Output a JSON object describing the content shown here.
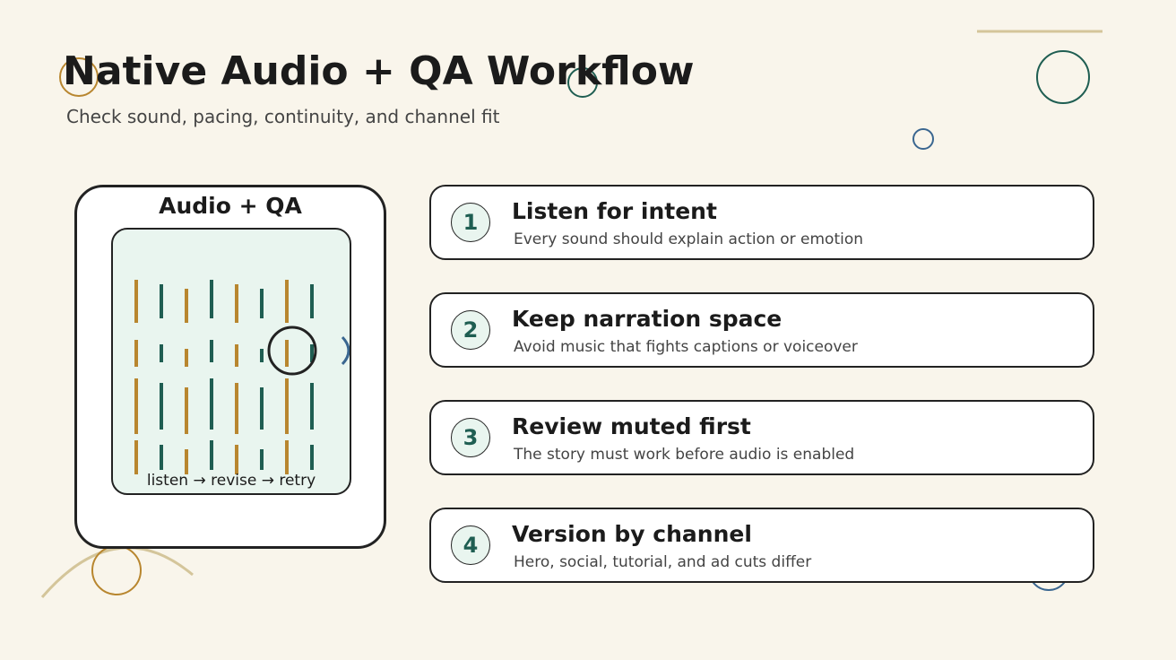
{
  "title": "Native Audio + QA Workflow",
  "subtitle": "Check sound, pacing, continuity, and channel fit",
  "card": {
    "title": "Audio + QA",
    "loop_label": "listen → revise → retry"
  },
  "steps": [
    {
      "number": "1",
      "title": "Listen for intent",
      "description": "Every sound should explain action or emotion"
    },
    {
      "number": "2",
      "title": "Keep narration space",
      "description": "Avoid music that fights captions or voiceover"
    },
    {
      "number": "3",
      "title": "Review muted first",
      "description": "The story must work before audio is enabled"
    },
    {
      "number": "4",
      "title": "Version by channel",
      "description": "Hero, social, tutorial, and ad cuts differ"
    }
  ],
  "colors": {
    "background": "#f9f5eb",
    "accent_gold": "#b8862f",
    "accent_teal": "#1f5e52",
    "accent_blue": "#3a6690",
    "panel_fill": "#e9f5ef",
    "line_tan": "#d4c59a"
  }
}
